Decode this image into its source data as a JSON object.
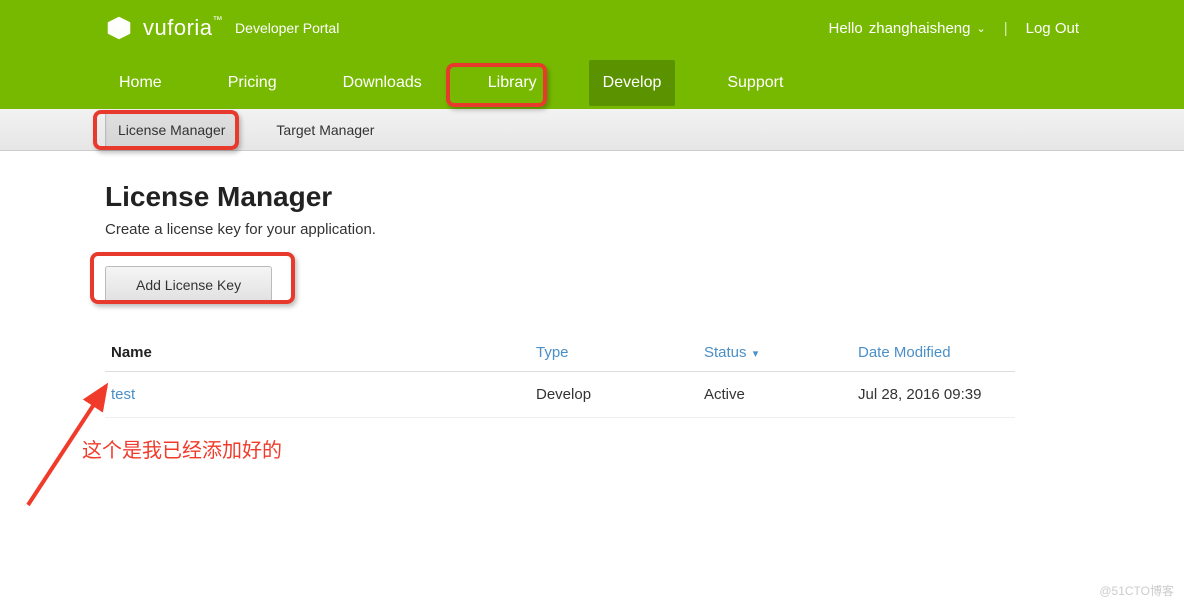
{
  "header": {
    "brand": "vuforia",
    "brand_sub": "Developer Portal",
    "greeting_prefix": "Hello",
    "username": "zhanghaisheng",
    "logout_label": "Log Out"
  },
  "nav": {
    "items": [
      {
        "label": "Home"
      },
      {
        "label": "Pricing"
      },
      {
        "label": "Downloads"
      },
      {
        "label": "Library"
      },
      {
        "label": "Develop",
        "active": true
      },
      {
        "label": "Support"
      }
    ]
  },
  "sub_nav": {
    "items": [
      {
        "label": "License Manager",
        "active": true
      },
      {
        "label": "Target Manager"
      }
    ]
  },
  "page": {
    "title": "License Manager",
    "description": "Create a license key for your application.",
    "add_button_label": "Add License Key"
  },
  "table": {
    "headers": {
      "name": "Name",
      "type": "Type",
      "status": "Status",
      "date_modified": "Date Modified"
    },
    "rows": [
      {
        "name": "test",
        "type": "Develop",
        "status": "Active",
        "date_modified": "Jul 28, 2016 09:39"
      }
    ]
  },
  "annotation": {
    "text": "这个是我已经添加好的"
  },
  "watermark": "@51CTO博客"
}
